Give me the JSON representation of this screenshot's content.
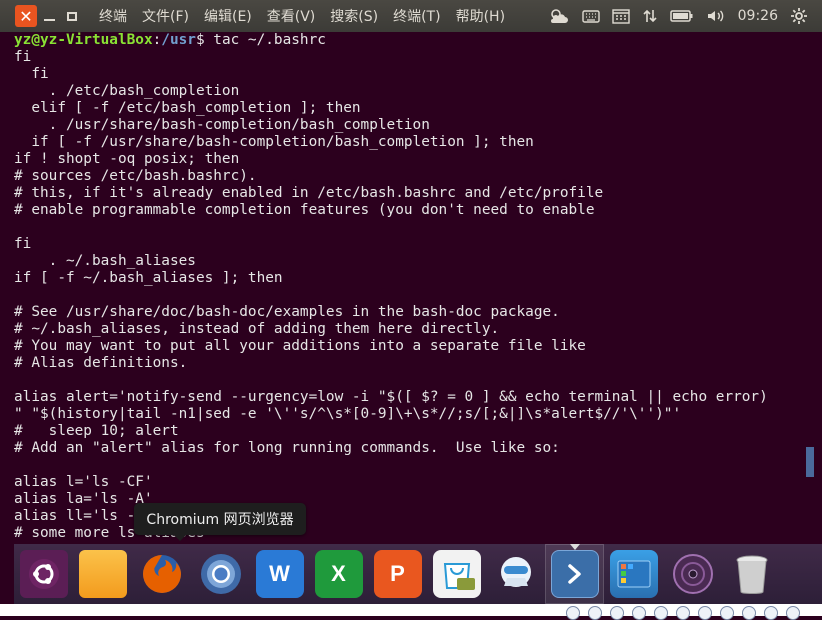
{
  "topbar": {
    "menus": [
      "终端",
      "文件(F)",
      "编辑(E)",
      "查看(V)",
      "搜索(S)",
      "终端(T)",
      "帮助(H)"
    ],
    "clock": "09:26",
    "icons": [
      "weather-icon",
      "keyboard-icon",
      "calendar-icon",
      "network-updown-icon",
      "battery-icon",
      "volume-icon",
      "gear-icon"
    ]
  },
  "terminal": {
    "prompt_user": "yz@yz-VirtualBox",
    "prompt_sep": ":",
    "prompt_path": "/usr",
    "prompt_command": "$ tac ~/.bashrc",
    "lines": [
      "fi",
      "  fi",
      "    . /etc/bash_completion",
      "  elif [ -f /etc/bash_completion ]; then",
      "    . /usr/share/bash-completion/bash_completion",
      "  if [ -f /usr/share/bash-completion/bash_completion ]; then",
      "if ! shopt -oq posix; then",
      "# sources /etc/bash.bashrc).",
      "# this, if it's already enabled in /etc/bash.bashrc and /etc/profile",
      "# enable programmable completion features (you don't need to enable",
      "",
      "fi",
      "    . ~/.bash_aliases",
      "if [ -f ~/.bash_aliases ]; then",
      "",
      "# See /usr/share/doc/bash-doc/examples in the bash-doc package.",
      "# ~/.bash_aliases, instead of adding them here directly.",
      "# You may want to put all your additions into a separate file like",
      "# Alias definitions.",
      "",
      "alias alert='notify-send --urgency=low -i \"$([ $? = 0 ] && echo terminal || echo error)",
      "\" \"$(history|tail -n1|sed -e '\\''s/^\\s*[0-9]\\+\\s*//;s/[;&|]\\s*alert$//'\\'')\"'",
      "#   sleep 10; alert",
      "# Add an \"alert\" alias for long running commands.  Use like so:",
      "",
      "alias l='ls -CF'",
      "alias la='ls -A'",
      "alias ll='ls -alF'",
      "# some more ls aliases"
    ]
  },
  "tooltip": {
    "text": "Chromium 网页浏览器"
  },
  "dock": {
    "apps": [
      {
        "name": "ubuntu-dash-icon",
        "color": "#7a2a6e"
      },
      {
        "name": "files-folder-icon",
        "color": "#f5a623"
      },
      {
        "name": "firefox-icon",
        "color": "#e66000"
      },
      {
        "name": "chromium-icon",
        "color": "#5a7fb8"
      },
      {
        "name": "wps-writer-icon",
        "color": "#2a7ad6"
      },
      {
        "name": "wps-spreadsheets-icon",
        "color": "#1f9a3c"
      },
      {
        "name": "wps-presentation-icon",
        "color": "#e9571f"
      },
      {
        "name": "ubuntu-software-center-icon",
        "color": "#f0f0f0"
      },
      {
        "name": "ubuntu-kylin-assistant-icon",
        "color": "#3a8bd0"
      },
      {
        "name": "terminal-icon",
        "color": "#3b6ea8"
      },
      {
        "name": "kylin-app-launcher-icon",
        "color": "#3a7fc8"
      },
      {
        "name": "dvd-disc-icon",
        "color": "#3c2a40"
      },
      {
        "name": "trash-icon",
        "color": "#d8d8d8"
      }
    ],
    "trash_label": ""
  }
}
